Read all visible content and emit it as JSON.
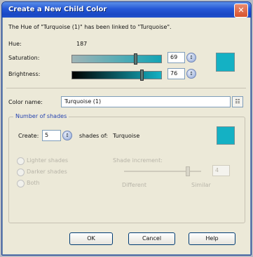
{
  "dialog": {
    "title": "Create a New Child Color",
    "close_glyph": "✕",
    "message": "The Hue of \"Turquoise (1)\" has been linked to \"Turquoise\".",
    "hue_label": "Hue:",
    "hue_value": "187",
    "saturation_label": "Saturation:",
    "saturation_value": "69",
    "saturation_level": 0.69,
    "brightness_label": "Brightness:",
    "brightness_value": "76",
    "brightness_level": 0.76,
    "color_name_label": "Color name:",
    "color_name_value": "Turquoise (1)",
    "accent_color": "#14b1c4"
  },
  "shades": {
    "group_label": "Number of shades",
    "create_label": "Create:",
    "create_value": "5",
    "shades_of_label": "shades of:",
    "shades_of_value": "Turquoise",
    "radio_lighter": "Lighter shades",
    "radio_darker": "Darker shades",
    "radio_both": "Both",
    "shade_increment_label": "Shade increment:",
    "slider_left_label": "Different",
    "slider_right_label": "Similar",
    "increment_value": "4"
  },
  "buttons": {
    "ok": "OK",
    "cancel": "Cancel",
    "help": "Help"
  }
}
